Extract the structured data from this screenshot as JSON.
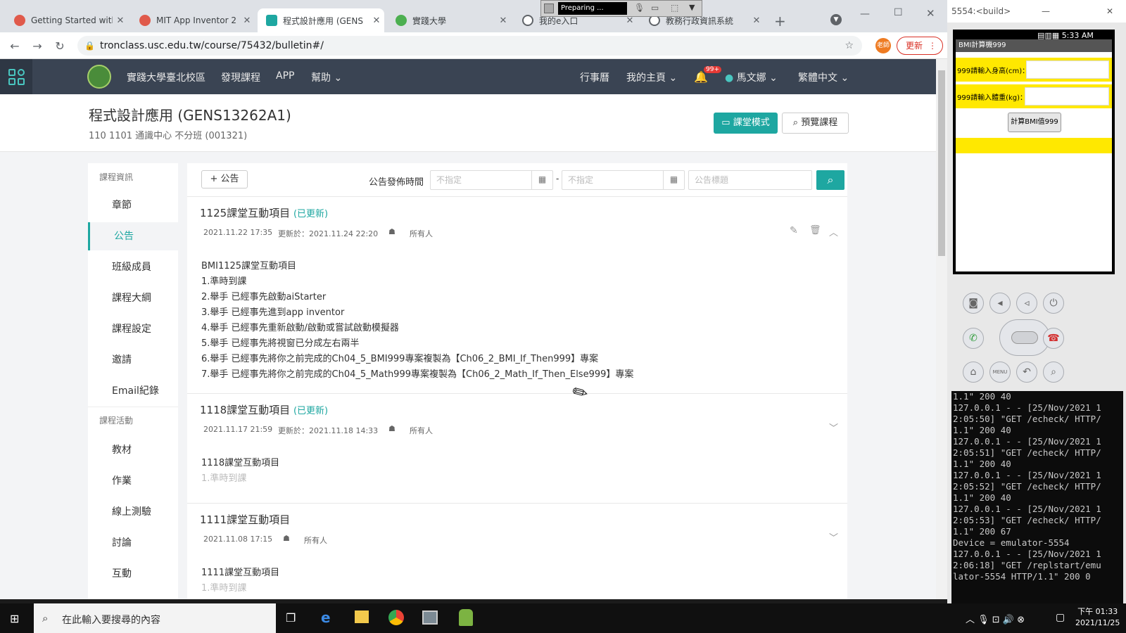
{
  "browser": {
    "tabs": [
      {
        "title": "Getting Started with",
        "color": "#e05a4b"
      },
      {
        "title": "MIT App Inventor 2",
        "color": "#e05a4b"
      },
      {
        "title": "程式設計應用 (GENS",
        "color": "#1ea7a1"
      },
      {
        "title": "實踐大學",
        "color": "#4caf50"
      },
      {
        "title": "我的e入口",
        "color": "#5f6368"
      },
      {
        "title": "教務行政資訊系統",
        "color": "#5f6368"
      }
    ],
    "url": "tronclass.usc.edu.tw/course/75432/bulletin#/",
    "update_label": "更新",
    "profile_label": "老師",
    "recorder_status": "Preparing ..."
  },
  "site": {
    "nav": [
      "實踐大學臺北校區",
      "發現課程",
      "APP",
      "幫助"
    ],
    "right": {
      "calendar": "行事曆",
      "my_home": "我的主頁",
      "badge": "99+",
      "user": "馬文娜",
      "language": "繁體中文"
    }
  },
  "course": {
    "title": "程式設計應用 (GENS13262A1)",
    "subtitle": "110 1101 通識中心 不分班 (001321)",
    "classroom_mode": "課堂模式",
    "preview": "預覽課程"
  },
  "sidebar": {
    "group1": "課程資訊",
    "items1": [
      "章節",
      "公告",
      "班級成員",
      "課程大綱",
      "課程設定",
      "邀請",
      "Email紀錄"
    ],
    "group2": "課程活動",
    "items2": [
      "教材",
      "作業",
      "線上測驗",
      "討論",
      "互動"
    ]
  },
  "toolbar": {
    "add": "公告",
    "date_label": "公告發佈時間",
    "date_from": "不指定",
    "date_to": "不指定",
    "dash": "-",
    "title_placeholder": "公告標題"
  },
  "posts": [
    {
      "title": "1125課堂互動項目",
      "updated": "(已更新)",
      "date": "2021.11.22 17:35",
      "updated_at": "更新於：2021.11.24 22:20",
      "audience": "所有人",
      "lines": [
        "BMI1125課堂互動項目",
        "1.準時到課",
        "2.舉手 已經事先啟動aiStarter",
        "3.舉手 已經事先進到app inventor",
        "4.舉手 已經事先重新啟動/啟動或嘗試啟動模擬器",
        "5.舉手 已經事先將視窗已分成左右兩半",
        "6.舉手 已經事先將你之前完成的Ch04_5_BMI999專案複製為【Ch06_2_BMI_If_Then999】專案",
        "7.舉手 已經事先將你之前完成的Ch04_5_Math999專案複製為【Ch06_2_Math_If_Then_Else999】專案"
      ]
    },
    {
      "title": "1118課堂互動項目",
      "updated": "(已更新)",
      "date": "2021.11.17 21:59",
      "updated_at": "更新於：2021.11.18 14:33",
      "audience": "所有人",
      "lines": [
        "1118課堂互動項目",
        "1.準時到課"
      ]
    },
    {
      "title": "1111課堂互動項目",
      "date": "2021.11.08 17:15",
      "audience": "所有人",
      "lines": [
        "1111課堂互動項目",
        "1.準時到課"
      ]
    }
  ],
  "emulator": {
    "window_title": "5554:<build>",
    "time": "5:33 AM",
    "app_title": "BMI計算機999",
    "height_label": "999請輸入身高(cm)：",
    "weight_label": "999請輸入體重(kg)：",
    "calc_button": "計算BMI值999"
  },
  "console_text": "1.1\" 200 40\n127.0.0.1 - - [25/Nov/2021 1\n2:05:50] \"GET /echeck/ HTTP/\n1.1\" 200 40\n127.0.0.1 - - [25/Nov/2021 1\n2:05:51] \"GET /echeck/ HTTP/\n1.1\" 200 40\n127.0.0.1 - - [25/Nov/2021 1\n2:05:52] \"GET /echeck/ HTTP/\n1.1\" 200 40\n127.0.0.1 - - [25/Nov/2021 1\n2:05:53] \"GET /echeck/ HTTP/\n1.1\" 200 67\nDevice = emulator-5554\n127.0.0.1 - - [25/Nov/2021 1\n2:06:18] \"GET /replstart/emu\nlator-5554 HTTP/1.1\" 200 0",
  "taskbar": {
    "search_placeholder": "在此輸入要搜尋的內容",
    "time": "下午 01:33",
    "date": "2021/11/25"
  }
}
